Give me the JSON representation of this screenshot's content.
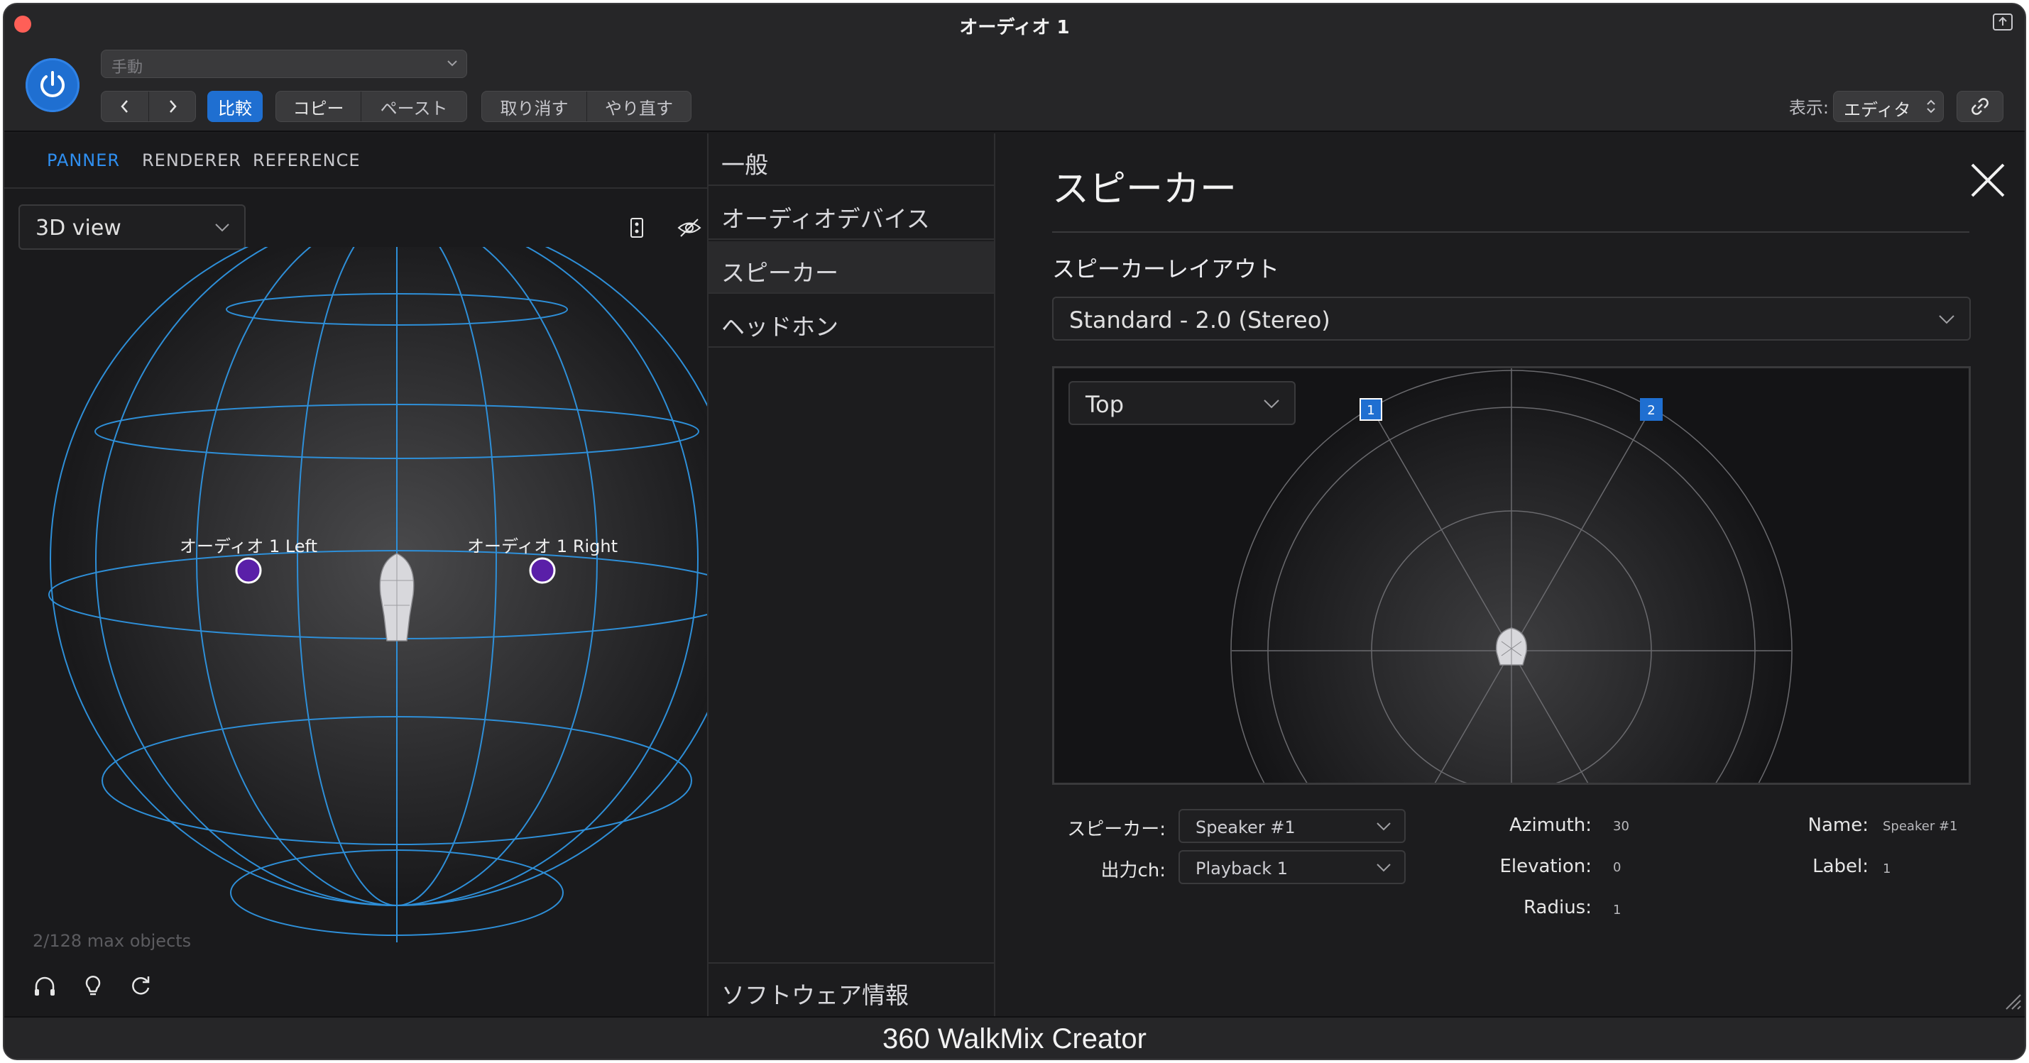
{
  "window": {
    "title": "オーディオ 1"
  },
  "toolbar": {
    "preset_placeholder": "手動",
    "compare_label": "比較",
    "copy_label": "コピー",
    "paste_label": "ペースト",
    "undo_label": "取り消す",
    "redo_label": "やり直す",
    "view_label": "表示:",
    "view_value": "エディタ"
  },
  "panner": {
    "tabs": [
      {
        "label": "PANNER",
        "active": true
      },
      {
        "label": "RENDERER",
        "active": false
      },
      {
        "label": "REFERENCE",
        "active": false
      }
    ],
    "view_mode": "3D view",
    "objects": [
      {
        "label": "オーディオ 1 Left"
      },
      {
        "label": "オーディオ 1 Right"
      }
    ],
    "max_objects": "2/128 max objects"
  },
  "menu": {
    "items": [
      {
        "label": "一般"
      },
      {
        "label": "オーディオデバイス"
      },
      {
        "label": "スピーカー",
        "selected": true
      },
      {
        "label": "ヘッドホン"
      }
    ],
    "bottom_item": "ソフトウェア情報"
  },
  "speakers": {
    "title": "スピーカー",
    "layout_label": "スピーカーレイアウト",
    "layout_value": "Standard - 2.0 (Stereo)",
    "view_value": "Top",
    "speaker_markers": [
      "1",
      "2"
    ],
    "fields": {
      "speaker_label": "スピーカー:",
      "speaker_value": "Speaker #1",
      "output_label": "出力ch:",
      "output_value": "Playback 1",
      "azimuth_label": "Azimuth:",
      "azimuth_value": "30",
      "elevation_label": "Elevation:",
      "elevation_value": "0",
      "radius_label": "Radius:",
      "radius_value": "1",
      "name_label": "Name:",
      "name_value": "Speaker #1",
      "label_label": "Label:",
      "label_value": "1"
    }
  },
  "footer": {
    "app_name": "360 WalkMix Creator"
  },
  "colors": {
    "accent": "#1f6fd1",
    "tab_active": "#2f8ff0",
    "grid": "#2e8fd8",
    "object": "#5a1fa8"
  }
}
